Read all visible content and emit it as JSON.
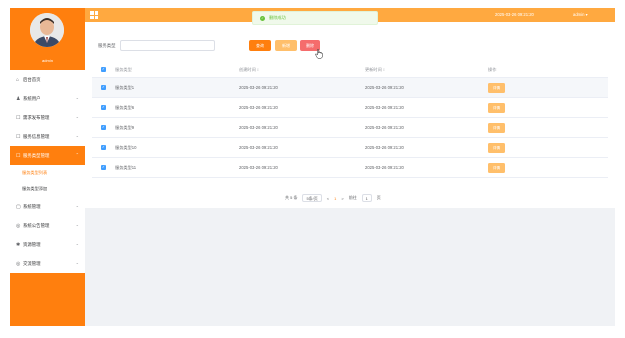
{
  "user": {
    "name": "admin"
  },
  "sidebar": {
    "items": [
      {
        "label": "后台首页",
        "icon": "home-icon",
        "glyph": "⌂"
      },
      {
        "label": "系统用户",
        "icon": "user-icon",
        "glyph": "♟"
      },
      {
        "label": "需求发布管理",
        "icon": "doc-icon",
        "glyph": "☐"
      },
      {
        "label": "服务信息管理",
        "icon": "doc-icon",
        "glyph": "☐"
      },
      {
        "label": "服务类型管理",
        "icon": "doc-icon",
        "glyph": "☐",
        "active": true
      },
      {
        "label": "服务类型列表",
        "sub": true,
        "selected": true
      },
      {
        "label": "服务类型添加",
        "sub": true
      },
      {
        "label": "系统管理",
        "icon": "box-icon",
        "glyph": "▢"
      },
      {
        "label": "系统公告管理",
        "icon": "info-icon",
        "glyph": "◎"
      },
      {
        "label": "资源管理",
        "icon": "gear-icon",
        "glyph": "✱"
      },
      {
        "label": "交流管理",
        "icon": "chat-icon",
        "glyph": "◎"
      }
    ]
  },
  "header": {
    "title": "社区服务在线管理系统",
    "datetime": "2025-03-26 09:21:20",
    "user_menu": "admin ▾"
  },
  "toast": {
    "message": "删除成功"
  },
  "search": {
    "label": "服务类型",
    "value": "",
    "placeholder": ""
  },
  "toolbar": {
    "search_label": "查询",
    "add_label": "新增",
    "delete_label": "删除"
  },
  "table": {
    "columns": [
      "服务类型",
      "创建时间 ↕",
      "更新时间 ↕",
      "操作"
    ],
    "detail_label": "详情",
    "rows": [
      {
        "type": "服务类型1",
        "created": "2025-03-26 09:21:20",
        "updated": "2025-03-26 09:21:20"
      },
      {
        "type": "服务类型6",
        "created": "2025-03-26 09:21:20",
        "updated": "2025-03-26 09:21:20"
      },
      {
        "type": "服务类型9",
        "created": "2025-03-26 09:21:20",
        "updated": "2025-03-26 09:21:20"
      },
      {
        "type": "服务类型10",
        "created": "2025-03-26 09:21:20",
        "updated": "2025-03-26 09:21:20"
      },
      {
        "type": "服务类型11",
        "created": "2025-03-26 09:21:20",
        "updated": "2025-03-26 09:21:20"
      }
    ]
  },
  "pagination": {
    "total": "共 5 条",
    "page_size": "5条/页",
    "prev": "<",
    "current": "1",
    "next": ">",
    "goto": "前往",
    "page_input": "1",
    "page_unit": "页"
  },
  "colors": {
    "accent": "#ff7f0e",
    "header": "#ffa940",
    "danger": "#f56c6c",
    "success": "#67c23a"
  }
}
